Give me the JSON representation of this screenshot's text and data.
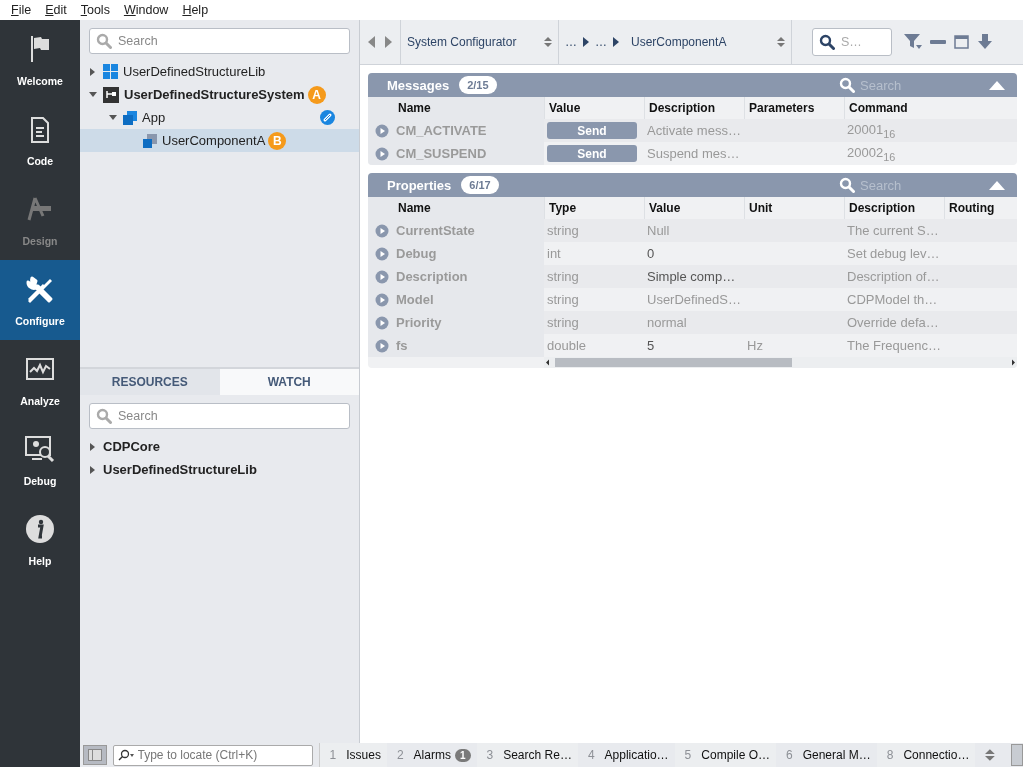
{
  "menu": [
    {
      "label": "File"
    },
    {
      "label": "Edit"
    },
    {
      "label": "Tools"
    },
    {
      "label": "Window"
    },
    {
      "label": "Help"
    }
  ],
  "nav": [
    {
      "label": "Welcome",
      "selected": false,
      "disabled": false
    },
    {
      "label": "Code",
      "selected": false,
      "disabled": false
    },
    {
      "label": "Design",
      "selected": false,
      "disabled": true
    },
    {
      "label": "Configure",
      "selected": true,
      "disabled": false
    },
    {
      "label": "Analyze",
      "selected": false,
      "disabled": false
    },
    {
      "label": "Debug",
      "selected": false,
      "disabled": false
    },
    {
      "label": "Help",
      "selected": false,
      "disabled": false
    }
  ],
  "project_tree": {
    "search": {
      "placeholder": "Search"
    },
    "items": [
      {
        "kind": "lib",
        "label": "UserDefinedStructureLib",
        "expanded": false,
        "selected": false
      },
      {
        "kind": "system",
        "label": "UserDefinedStructureSystem",
        "expanded": true,
        "selected": false,
        "badge": "A",
        "children": [
          {
            "kind": "app",
            "label": "App",
            "expanded": true,
            "selected": false,
            "linked": true,
            "children": [
              {
                "kind": "component",
                "label": "UserComponentA",
                "selected": true,
                "badge": "B"
              }
            ]
          }
        ]
      }
    ]
  },
  "bottom_tabs": [
    {
      "label": "RESOURCES",
      "selected": true
    },
    {
      "label": "WATCH",
      "selected": false
    }
  ],
  "resources": {
    "search": {
      "placeholder": "Search"
    },
    "items": [
      {
        "label": "CDPCore",
        "expanded": false
      },
      {
        "label": "UserDefinedStructureLib",
        "expanded": false
      }
    ]
  },
  "toolbar": {
    "context": "System Configurator",
    "path": [
      "…",
      "…",
      "UserComponentA"
    ],
    "search": {
      "placeholder": "S…"
    }
  },
  "messages": {
    "title": "Messages",
    "count": "2/15",
    "search": {
      "placeholder": "Search"
    },
    "columns": [
      "Name",
      "Value",
      "Description",
      "Parameters",
      "Command"
    ],
    "rows": [
      {
        "name": "CM_ACTIVATE",
        "button": "Send",
        "description": "Activate mess…",
        "parameters": "",
        "command": "20001$_{16}$"
      },
      {
        "name": "CM_SUSPEND",
        "button": "Send",
        "description": "Suspend mes…",
        "parameters": "",
        "command": "20002$_{16}$"
      }
    ]
  },
  "properties": {
    "title": "Properties",
    "count": "6/17",
    "search": {
      "placeholder": "Search"
    },
    "columns": [
      "Name",
      "Type",
      "Value",
      "Unit",
      "Description",
      "Routing"
    ],
    "rows": [
      {
        "name": "CurrentState",
        "type": "string",
        "value": "Null",
        "value_set": false,
        "unit": "",
        "description": "The current S…"
      },
      {
        "name": "Debug",
        "type": "int",
        "value": "0",
        "value_set": true,
        "unit": "",
        "description": "Set debug lev…"
      },
      {
        "name": "Description",
        "type": "string",
        "value": "Simple comp…",
        "value_set": true,
        "unit": "",
        "description": "Description of…"
      },
      {
        "name": "Model",
        "type": "string",
        "value": "UserDefinedS…",
        "value_set": false,
        "unit": "",
        "description": "CDPModel th…"
      },
      {
        "name": "Priority",
        "type": "string",
        "value": "normal",
        "value_set": false,
        "unit": "",
        "description": "Override defa…"
      },
      {
        "name": "fs",
        "type": "double",
        "value": "5",
        "value_set": true,
        "unit": "Hz",
        "description": "The Frequenc…"
      }
    ]
  },
  "status_bar": {
    "locate": {
      "placeholder": "Type to locate (Ctrl+K)"
    },
    "tabs": [
      {
        "number": "1",
        "label": "Issues"
      },
      {
        "number": "2",
        "label": "Alarms",
        "badge": "1"
      },
      {
        "number": "3",
        "label": "Search Re…"
      },
      {
        "number": "4",
        "label": "Applicatio…"
      },
      {
        "number": "5",
        "label": "Compile O…"
      },
      {
        "number": "6",
        "label": "General M…"
      },
      {
        "number": "8",
        "label": "Connectio…"
      }
    ]
  }
}
